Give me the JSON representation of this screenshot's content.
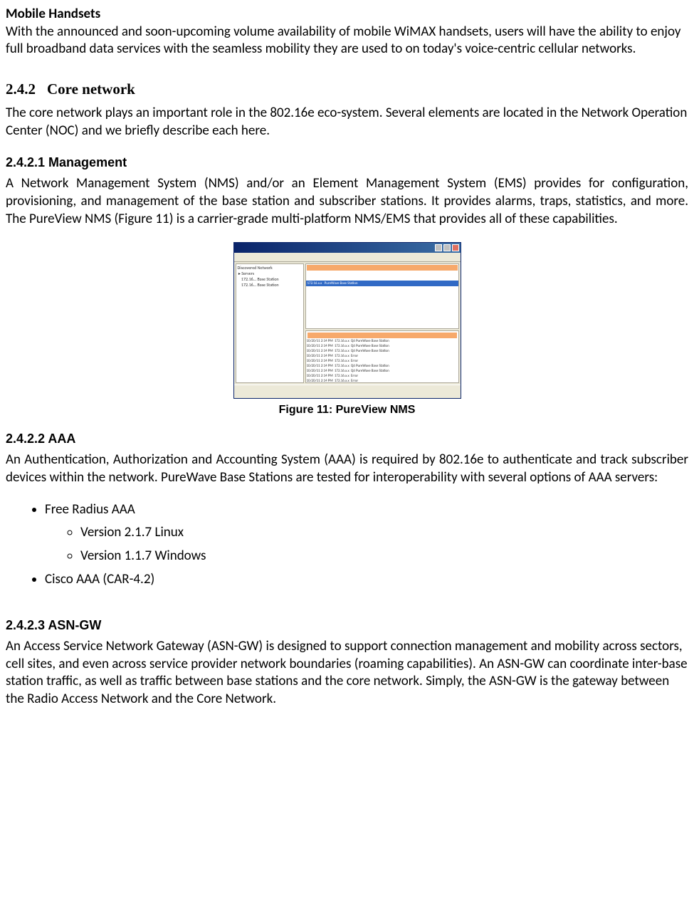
{
  "mobile_handsets": {
    "heading": "Mobile Handsets",
    "body": "With the announced and soon-upcoming volume availability of mobile WiMAX handsets, users will have the ability to enjoy full broadband data services with the seamless mobility they are used to on today's voice-centric cellular networks."
  },
  "section_core": {
    "number": "2.4.2",
    "title": "Core network",
    "body": "The core network plays an important role in the 802.16e eco-system. Several elements are located in the Network Operation Center (NOC) and we briefly describe each here."
  },
  "management": {
    "heading": "2.4.2.1 Management",
    "body": "A Network Management System (NMS) and/or an Element Management System (EMS) provides for configuration, provisioning, and management of the base station and subscriber stations. It provides alarms, traps, statistics, and more.   The PureView NMS  (Figure 11) is a carrier-grade multi-platform NMS/EMS that provides all of these capabilities.",
    "figure_caption": "Figure 11: PureView NMS"
  },
  "aaa": {
    "heading": "2.4.2.2 AAA",
    "body": "An Authentication, Authorization and Accounting System (AAA) is required by 802.16e to authenticate and track subscriber devices within the network. PureWave Base Stations are tested for interoperability with several options of AAA servers:",
    "list": {
      "item1": "Free Radius AAA",
      "sub1": "Version 2.1.7 Linux",
      "sub2": "Version 1.1.7 Windows",
      "item2": "Cisco AAA (CAR-4.2)"
    }
  },
  "asngw": {
    "heading": "2.4.2.3 ASN-GW",
    "body": "An Access Service Network Gateway (ASN-GW) is designed to support connection management and mobility across sectors, cell sites, and even across service provider network boundaries (roaming capabilities).   An ASN-GW can coordinate inter-base station traffic, as well as traffic between base stations and the core network.  Simply, the ASN-GW is the gateway between the Radio Access Network and the Core Network."
  }
}
